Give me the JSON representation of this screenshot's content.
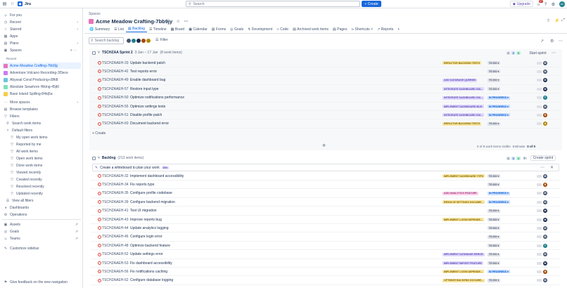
{
  "topbar": {
    "app_name": "Jira",
    "search_placeholder": "Search",
    "create_label": "+ Create",
    "upgrade_label": "Upgrade",
    "notification_count": "9+",
    "avatar_initials": "AC"
  },
  "sidebar": {
    "for_you": "For you",
    "recent": "Recent",
    "starred": "Starred",
    "apps": "Apps",
    "plans": "Plans",
    "spaces": "Spaces",
    "recent_header": "Recent",
    "spaces_list": [
      {
        "label": "Acme Meadow Crafting-7bb9jy",
        "color": "#e774bb"
      },
      {
        "label": "Adventure Volcano Recording-3f3ece",
        "color": "#c97cf4"
      },
      {
        "label": "Abyssal Coral Producing-c8fti8",
        "color": "#6cc3e0"
      },
      {
        "label": "Absolute Seashore Hiking-45jt0",
        "color": "#7ee2b8"
      },
      {
        "label": "Base Island Spilling-84tq5a",
        "color": "#f5cd47"
      }
    ],
    "more_spaces": "More spaces",
    "browse_templates": "Browse templates",
    "filters": "Filters",
    "search_work_items": "Search work items",
    "default_filters": "Default filters",
    "filter_items": [
      "My open work items",
      "Reported by me",
      "All work items",
      "Open work items",
      "Done work items",
      "Viewed recently",
      "Created recently",
      "Resolved recently",
      "Updated recently"
    ],
    "view_all_filters": "View all filters",
    "dashboards": "Dashboards",
    "operations": "Operations",
    "assets": "Assets",
    "goals": "Goals",
    "teams": "Teams",
    "customize": "Customize sidebar",
    "feedback": "Give feedback on the new navigation"
  },
  "header": {
    "breadcrumb": "Spaces",
    "title": "Acme Meadow Crafting-7bb9jy",
    "tabs": [
      "Summary",
      "List",
      "Backlog",
      "Timeline",
      "Board",
      "Calendar",
      "Forms",
      "Goals",
      "Development",
      "Code",
      "Archived work items",
      "Pages",
      "Shortcuts",
      "Reports"
    ],
    "active_tab": "Backlog"
  },
  "toolbar": {
    "search_placeholder": "Search backlog",
    "filter_label": "Filter"
  },
  "sprint": {
    "title": "TSCHZAA Sprint 2",
    "dates": "3 Jan – 17 Jan",
    "count": "(8 work items)",
    "counts": [
      "0",
      "0",
      "0"
    ],
    "start_label": "Start sprint",
    "items": [
      {
        "key": "TSCHZAAEH-33",
        "summary": "Update backend patch",
        "epic": "REFACTOR BACKEND TESTS",
        "epic_bg": "#f8e6a0",
        "epic_fg": "#7f5f01",
        "status": "TO DO ▾",
        "status_type": "todo",
        "avatar_color": "#44546f",
        "avatar": "M"
      },
      {
        "key": "TSCHZAAEH-42",
        "summary": "Test reports error",
        "epic": "",
        "epic_bg": "",
        "epic_fg": "",
        "status": "TO DO ▾",
        "status_type": "todo",
        "avatar_color": "#44546f",
        "avatar": "M"
      },
      {
        "key": "TSCHZAAEH-49",
        "summary": "Enable dashboard bug",
        "epic": "ADD DATABASE QUERIES",
        "epic_bg": "#dfd8fd",
        "epic_fg": "#5e4db2",
        "status": "TO DO ▾",
        "status_type": "todo",
        "avatar_color": "#172b4d",
        "avatar": "M"
      },
      {
        "key": "TSCHZAAEH-57",
        "summary": "Restore input type",
        "epic": "INTEGRATE DASHBOARD GUI...",
        "epic_bg": "#dfd8fd",
        "epic_fg": "#5e4db2",
        "status": "TO DO ▾",
        "status_type": "todo",
        "avatar_color": "#172b4d",
        "avatar": "M"
      },
      {
        "key": "TSCHZAAEH-50",
        "summary": "Optimize notifications performance",
        "epic": "INTEGRATE DASHBOARD GUI...",
        "epic_bg": "#dfd8fd",
        "epic_fg": "#5e4db2",
        "status": "IN PROGRESS ▾",
        "status_type": "prog",
        "avatar_color": "#1d7f8c",
        "avatar": "T"
      },
      {
        "key": "TSCHZAAEH-55",
        "summary": "Optimize settings tests",
        "epic": "IMPLEMENT DASHBOARD BUG",
        "epic_bg": "#dfd8fd",
        "epic_fg": "#5e4db2",
        "status": "IN PROGRESS ▾",
        "status_type": "prog",
        "avatar_color": "#44546f",
        "avatar": "M"
      },
      {
        "key": "TSCHZAAEH-51",
        "summary": "Disable profile patch",
        "epic": "INTEGRATE DASHBOARD GUI...",
        "epic_bg": "#dfd8fd",
        "epic_fg": "#5e4db2",
        "status": "IN PROGRESS ▾",
        "status_type": "prog",
        "avatar_color": "#a54800",
        "avatar": "R"
      },
      {
        "key": "TSCHZAAEH-60",
        "summary": "Document backend error",
        "epic": "REFACTOR BACKEND TESTS",
        "epic_bg": "#f8e6a0",
        "epic_fg": "#7f5f01",
        "status": "TO DO ▾",
        "status_type": "todo",
        "avatar_color": "#b38600",
        "avatar": "A"
      }
    ],
    "create_label": "+ Create",
    "visible_text": "0 of 8 work items visible",
    "estimate_text": "Estimate",
    "estimate_value": "0 of 0"
  },
  "backlog": {
    "title": "Backlog",
    "count": "(213 work items)",
    "counts": [
      "0",
      "0",
      "0"
    ],
    "create_sprint": "Create sprint",
    "whiteboard_text": "Create a whiteboard to plan your work",
    "whiteboard_badge": "TRY",
    "items": [
      {
        "key": "TSCHZAAEH-32",
        "summary": "Implement dashboard accessibility",
        "epic": "IMPLEMENT DASHBOARD TYPO",
        "epic_bg": "#f8e6a0",
        "epic_fg": "#7f5f01",
        "status": "TO DO ▾",
        "status_type": "todo",
        "avatar_color": "#44546f",
        "avatar": "M"
      },
      {
        "key": "TSCHZAAEH-34",
        "summary": "Fix reports typo",
        "epic": "",
        "epic_bg": "",
        "epic_fg": "",
        "status": "TO DO ▾",
        "status_type": "todo",
        "avatar_color": "#a54800",
        "avatar": "R"
      },
      {
        "key": "TSCHZAAEH-35",
        "summary": "Configure profile codebase",
        "epic": "ADD ANALYTICS FEATURE",
        "epic_bg": "#fdd0ec",
        "epic_fg": "#943d73",
        "status": "IN PROGRESS ▾",
        "status_type": "prog",
        "avatar_color": "#44546f",
        "avatar": "M"
      },
      {
        "key": "TSCHZAAEH-39",
        "summary": "Configure backend migration",
        "epic": "RESOLVE SETTINGS DOCUME...",
        "epic_bg": "#f8e6a0",
        "epic_fg": "#7f5f01",
        "status": "IN PROGRESS ▾",
        "status_type": "prog",
        "avatar_color": "#44546f",
        "avatar": "M"
      },
      {
        "key": "TSCHZAAEH-41",
        "summary": "Test UI migration",
        "epic": "",
        "epic_bg": "",
        "epic_fg": "",
        "status": "TO DO ▾",
        "status_type": "todo",
        "avatar_color": "#172b4d",
        "avatar": "M"
      },
      {
        "key": "TSCHZAAEH-43",
        "summary": "Improve reports bug",
        "epic": "IMPLEMENT LOGIN DEPENDE...",
        "epic_bg": "#f8e6a0",
        "epic_fg": "#7f5f01",
        "status": "TO DO ▾",
        "status_type": "todo",
        "avatar_color": "#172b4d",
        "avatar": "M"
      },
      {
        "key": "TSCHZAAEH-44",
        "summary": "Update analytics logging",
        "epic": "",
        "epic_bg": "",
        "epic_fg": "",
        "status": "TO DO ▾",
        "status_type": "todo",
        "avatar_color": "#44546f",
        "avatar": "M"
      },
      {
        "key": "TSCHZAAEH-46",
        "summary": "Configure login error",
        "epic": "",
        "epic_bg": "",
        "epic_fg": "",
        "status": "TO DO ▾",
        "status_type": "todo",
        "avatar_color": "#44546f",
        "avatar": "M"
      },
      {
        "key": "TSCHZAAEH-48",
        "summary": "Optimize backend feature",
        "epic": "",
        "epic_bg": "",
        "epic_fg": "",
        "status": "TO DO ▾",
        "status_type": "todo",
        "avatar_color": "#1d7f8c",
        "avatar": "T"
      },
      {
        "key": "TSCHZAAEH-52",
        "summary": "Update settings error",
        "epic": "IMPLEMENT DATABASE ERROR",
        "epic_bg": "#dfd8fd",
        "epic_fg": "#5e4db2",
        "status": "TO DO ▾",
        "status_type": "todo",
        "avatar_color": "#44546f",
        "avatar": "M"
      },
      {
        "key": "TSCHZAAEH-53",
        "summary": "Fix dashboard accessibility",
        "epic": "IMPLEMENT IMPORT FEATURE",
        "epic_bg": "#dfd8fd",
        "epic_fg": "#5e4db2",
        "status": "TO DO ▾",
        "status_type": "todo",
        "avatar_color": "#172b4d",
        "avatar": "M"
      },
      {
        "key": "TSCHZAAEH-56",
        "summary": "Fix notifications caching",
        "epic": "IMPLEMENT LOGIN DEPENDE...",
        "epic_bg": "#f8e6a0",
        "epic_fg": "#7f5f01",
        "status": "IN PROGRESS ▾",
        "status_type": "prog",
        "avatar_color": "#a54800",
        "avatar": "R"
      },
      {
        "key": "TSCHZAAEH-62",
        "summary": "Configure database logging",
        "epic": "OPTIMIZE BACKEND DOCUME...",
        "epic_bg": "#f8e6a0",
        "epic_fg": "#7f5f01",
        "status": "TO DO ▾",
        "status_type": "todo",
        "avatar_color": "#44546f",
        "avatar": "M"
      }
    ]
  }
}
